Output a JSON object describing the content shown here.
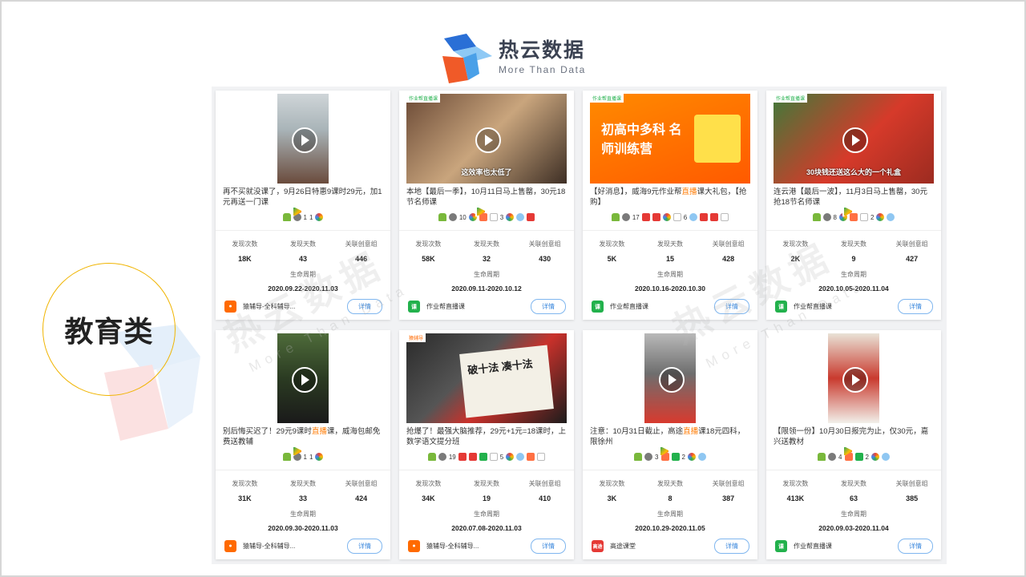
{
  "brand": {
    "name_cn": "热云数据",
    "name_en": "More Than Data"
  },
  "watermark": {
    "cn": "热云数据",
    "en": "More Than Data"
  },
  "category": "教育类",
  "labels": {
    "found_count": "发现次数",
    "found_days": "发现天数",
    "linked_groups": "关联创意组",
    "lifecycle": "生命周期",
    "detail": "详情"
  },
  "cards": [
    {
      "thumb_overlay": "",
      "desc_before": "再不买就没课了，9月26日特惠9课时29元，加1元再送一门课",
      "desc_hl": "",
      "desc_after": "",
      "platform_counts": [
        "1",
        "1"
      ],
      "found_count": "18K",
      "found_days": "43",
      "linked_groups": "446",
      "lifecycle": "2020.09.22-2020.11.03",
      "app_name": "猿辅导-全科辅导...",
      "app_icon_color": "#ff6a00"
    },
    {
      "thumb_overlay": "这效率也太低了",
      "desc_before": "本地【最后一季】，10月11日马上售罄，30元18节名师课",
      "desc_hl": "",
      "desc_after": "",
      "platform_counts": [
        "10",
        "3"
      ],
      "found_count": "58K",
      "found_days": "32",
      "linked_groups": "430",
      "lifecycle": "2020.09.11-2020.10.12",
      "app_name": "作业帮直播课",
      "app_icon_color": "#22b14c"
    },
    {
      "thumb_overlay": "初高中多科 名师训练营",
      "desc_before": "【好消息】，威海9元作业帮",
      "desc_hl": "直播",
      "desc_after": "课大礼包，【抢购】",
      "platform_counts": [
        "17",
        "6"
      ],
      "found_count": "5K",
      "found_days": "15",
      "linked_groups": "428",
      "lifecycle": "2020.10.16-2020.10.30",
      "app_name": "作业帮直播课",
      "app_icon_color": "#22b14c"
    },
    {
      "thumb_overlay": "30块钱还送这么大的一个礼盒",
      "desc_before": "连云港【最后一波】，11月3日马上售罄，30元抢18节名师课",
      "desc_hl": "",
      "desc_after": "",
      "platform_counts": [
        "8",
        "2"
      ],
      "found_count": "2K",
      "found_days": "9",
      "linked_groups": "427",
      "lifecycle": "2020.10.05-2020.11.04",
      "app_name": "作业帮直播课",
      "app_icon_color": "#22b14c"
    },
    {
      "thumb_overlay": "",
      "desc_before": "别后悔买迟了！29元9课时",
      "desc_hl": "直播",
      "desc_after": "课，威海包邮免费送教辅",
      "platform_counts": [
        "1",
        "1"
      ],
      "found_count": "31K",
      "found_days": "33",
      "linked_groups": "424",
      "lifecycle": "2020.09.30-2020.11.03",
      "app_name": "猿辅导-全科辅导...",
      "app_icon_color": "#ff6a00"
    },
    {
      "thumb_overlay": "破十法 凑十法",
      "desc_before": "抢爆了！最强大脑推荐，29元+1元=18课时，上数学语文提分班",
      "desc_hl": "",
      "desc_after": "",
      "platform_counts": [
        "19",
        "5"
      ],
      "found_count": "34K",
      "found_days": "19",
      "linked_groups": "410",
      "lifecycle": "2020.07.08-2020.11.03",
      "app_name": "猿辅导-全科辅导...",
      "app_icon_color": "#ff6a00"
    },
    {
      "thumb_overlay": "",
      "desc_before": "注意：10月31日截止，高途",
      "desc_hl": "直播",
      "desc_after": "课18元四科，限徐州",
      "platform_counts": [
        "3",
        "2"
      ],
      "found_count": "3K",
      "found_days": "8",
      "linked_groups": "387",
      "lifecycle": "2020.10.29-2020.11.05",
      "app_name": "高途课堂",
      "app_icon_color": "#e53935",
      "app_icon_text": "高途"
    },
    {
      "thumb_overlay": "",
      "desc_before": "【限领一份】10月30日报完为止，仅30元，嘉兴送教材",
      "desc_hl": "",
      "desc_after": "",
      "platform_counts": [
        "4",
        "2"
      ],
      "found_count": "413K",
      "found_days": "63",
      "linked_groups": "385",
      "lifecycle": "2020.09.03-2020.11.04",
      "app_name": "作业帮直播课",
      "app_icon_color": "#22b14c"
    }
  ]
}
